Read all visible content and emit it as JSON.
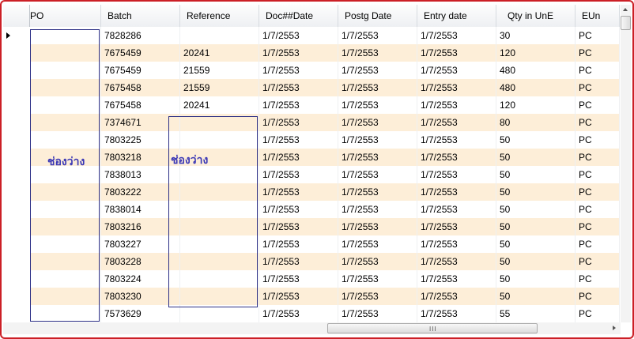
{
  "columns": [
    "PO",
    "Batch",
    "Reference",
    "Doc##Date",
    "Postg Date",
    "Entry date",
    "Qty in UnE",
    "EUn"
  ],
  "rows": [
    {
      "batch": "7828286",
      "reference": "",
      "doc_date": "1/7/2553",
      "postg_date": "1/7/2553",
      "entry_date": "1/7/2553",
      "qty": "30",
      "eun": "PC"
    },
    {
      "batch": "7675459",
      "reference": "20241",
      "doc_date": "1/7/2553",
      "postg_date": "1/7/2553",
      "entry_date": "1/7/2553",
      "qty": "120",
      "eun": "PC"
    },
    {
      "batch": "7675459",
      "reference": "21559",
      "doc_date": "1/7/2553",
      "postg_date": "1/7/2553",
      "entry_date": "1/7/2553",
      "qty": "480",
      "eun": "PC"
    },
    {
      "batch": "7675458",
      "reference": "21559",
      "doc_date": "1/7/2553",
      "postg_date": "1/7/2553",
      "entry_date": "1/7/2553",
      "qty": "480",
      "eun": "PC"
    },
    {
      "batch": "7675458",
      "reference": "20241",
      "doc_date": "1/7/2553",
      "postg_date": "1/7/2553",
      "entry_date": "1/7/2553",
      "qty": "120",
      "eun": "PC"
    },
    {
      "batch": "7374671",
      "reference": "",
      "doc_date": "1/7/2553",
      "postg_date": "1/7/2553",
      "entry_date": "1/7/2553",
      "qty": "80",
      "eun": "PC"
    },
    {
      "batch": "7803225",
      "reference": "",
      "doc_date": "1/7/2553",
      "postg_date": "1/7/2553",
      "entry_date": "1/7/2553",
      "qty": "50",
      "eun": "PC"
    },
    {
      "batch": "7803218",
      "reference": "",
      "doc_date": "1/7/2553",
      "postg_date": "1/7/2553",
      "entry_date": "1/7/2553",
      "qty": "50",
      "eun": "PC"
    },
    {
      "batch": "7838013",
      "reference": "",
      "doc_date": "1/7/2553",
      "postg_date": "1/7/2553",
      "entry_date": "1/7/2553",
      "qty": "50",
      "eun": "PC"
    },
    {
      "batch": "7803222",
      "reference": "",
      "doc_date": "1/7/2553",
      "postg_date": "1/7/2553",
      "entry_date": "1/7/2553",
      "qty": "50",
      "eun": "PC"
    },
    {
      "batch": "7838014",
      "reference": "",
      "doc_date": "1/7/2553",
      "postg_date": "1/7/2553",
      "entry_date": "1/7/2553",
      "qty": "50",
      "eun": "PC"
    },
    {
      "batch": "7803216",
      "reference": "",
      "doc_date": "1/7/2553",
      "postg_date": "1/7/2553",
      "entry_date": "1/7/2553",
      "qty": "50",
      "eun": "PC"
    },
    {
      "batch": "7803227",
      "reference": "",
      "doc_date": "1/7/2553",
      "postg_date": "1/7/2553",
      "entry_date": "1/7/2553",
      "qty": "50",
      "eun": "PC"
    },
    {
      "batch": "7803228",
      "reference": "",
      "doc_date": "1/7/2553",
      "postg_date": "1/7/2553",
      "entry_date": "1/7/2553",
      "qty": "50",
      "eun": "PC"
    },
    {
      "batch": "7803224",
      "reference": "",
      "doc_date": "1/7/2553",
      "postg_date": "1/7/2553",
      "entry_date": "1/7/2553",
      "qty": "50",
      "eun": "PC"
    },
    {
      "batch": "7803230",
      "reference": "",
      "doc_date": "1/7/2553",
      "postg_date": "1/7/2553",
      "entry_date": "1/7/2553",
      "qty": "50",
      "eun": "PC"
    },
    {
      "batch": "7573629",
      "reference": "",
      "doc_date": "1/7/2553",
      "postg_date": "1/7/2553",
      "entry_date": "1/7/2553",
      "qty": "55",
      "eun": "PC"
    }
  ],
  "annotations": {
    "po_label": "ช่องว่าง",
    "reference_label": "ช่องว่าง"
  },
  "hscroll_grip": "III",
  "colors": {
    "frame_border": "#cc1f26",
    "alt_row": "#fdeed8",
    "annotation_box": "#2c2f86",
    "annotation_text": "#3a37b5"
  }
}
